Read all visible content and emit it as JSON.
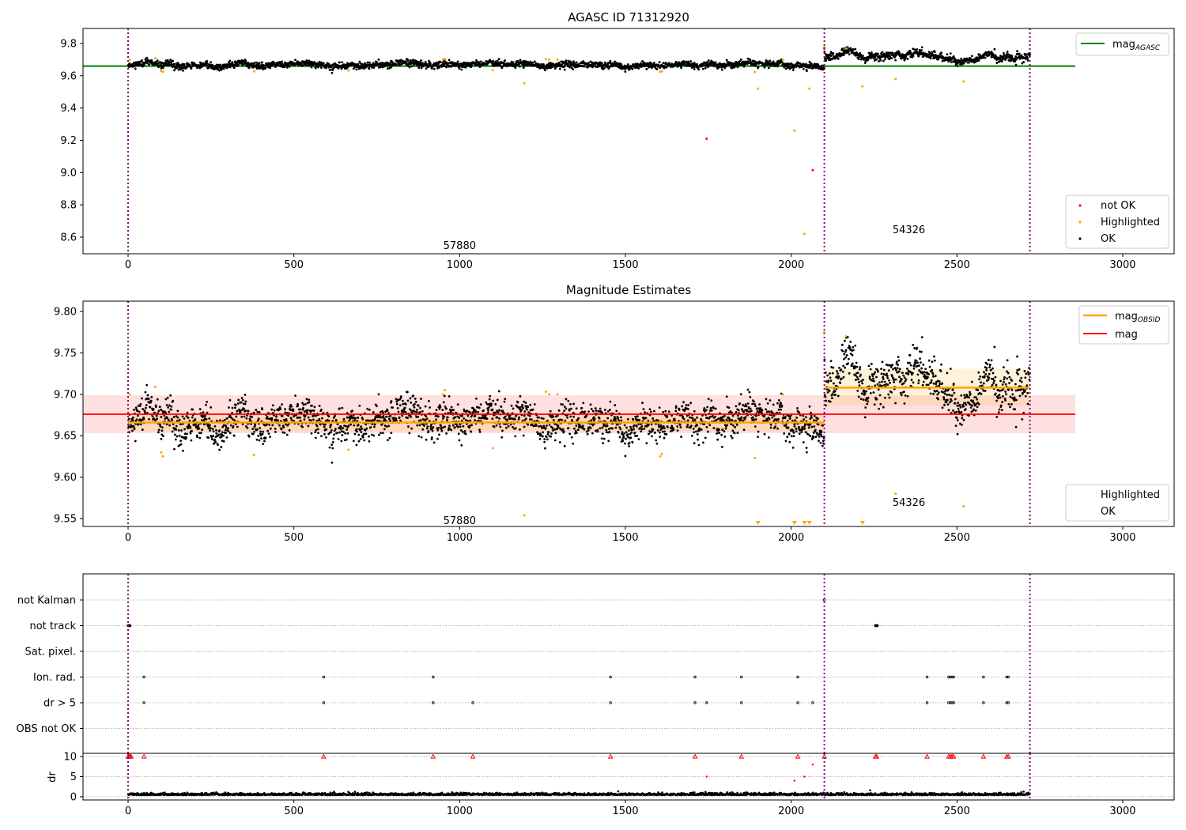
{
  "chart_data": [
    {
      "type": "scatter",
      "title": "AGASC ID 71312920",
      "ylim": [
        8.497,
        9.893
      ],
      "xlim": [
        -137,
        3154
      ],
      "xticks": [
        0,
        500,
        1000,
        1500,
        2000,
        2500,
        3000
      ],
      "yticks": [
        8.6,
        8.8,
        9.0,
        9.2,
        9.4,
        9.6,
        9.8
      ],
      "legend_upper": {
        "placement": "top-right",
        "entries": [
          "mag_AGASC"
        ]
      },
      "legend_lower": {
        "placement": "bottom-right",
        "entries": [
          "not OK",
          "Highlighted",
          "OK"
        ]
      },
      "mag_agasc": 9.66,
      "obsid_labels": [
        {
          "text": "57880",
          "x": 1000,
          "y": 8.55
        },
        {
          "text": "54326",
          "x": 2355,
          "y": 8.65
        }
      ],
      "not_ok": [
        [
          1745,
          9.21
        ],
        [
          2065,
          9.015
        ],
        [
          2100,
          9.77
        ]
      ]
    },
    {
      "type": "scatter",
      "title": "Magnitude Estimates",
      "ylim": [
        9.5405,
        9.8124
      ],
      "xlim": [
        -137,
        3154
      ],
      "xticks": [
        0,
        500,
        1000,
        1500,
        2000,
        2500,
        3000
      ],
      "yticks": [
        9.55,
        9.6,
        9.65,
        9.7,
        9.75,
        9.8
      ],
      "legend_upper": {
        "placement": "top-right",
        "entries": [
          "mag_OBSID",
          "mag"
        ]
      },
      "legend_lower": {
        "placement": "bottom-right",
        "entries": [
          "Highlighted",
          "OK"
        ]
      },
      "mag": 9.676,
      "mag_band": [
        9.653,
        9.699
      ],
      "obsid_labels": [
        {
          "text": "57880",
          "x": 1000,
          "y": 9.548
        },
        {
          "text": "54326",
          "x": 2355,
          "y": 9.57
        }
      ]
    },
    {
      "type": "scatter",
      "title": "Flags",
      "categories": [
        "not Kalman",
        "not track",
        "Sat. pixel.",
        "Ion. rad.",
        "dr > 5",
        "OBS not OK"
      ],
      "flags": {
        "not Kalman": [
          2100
        ],
        "not track": [
          0,
          2,
          4,
          6,
          2254,
          2256,
          2258,
          2260
        ],
        "Sat. pixel.": [],
        "Ion. rad.": [
          48,
          590,
          920,
          1455,
          1710,
          1850,
          2020,
          2410,
          2475,
          2480,
          2485,
          2490,
          2580,
          2650,
          2655
        ],
        "dr > 5": [
          48,
          590,
          920,
          1040,
          1455,
          1710,
          1745,
          1850,
          2020,
          2065,
          2410,
          2475,
          2480,
          2485,
          2490,
          2580,
          2650,
          2655
        ],
        "OBS not OK": []
      }
    },
    {
      "type": "scatter",
      "ylabel": "dr",
      "ylim": [
        -0.8,
        10.8
      ],
      "yticks": [
        0,
        5,
        10
      ],
      "xticks": [
        0,
        500,
        1000,
        1500,
        2000,
        2500,
        3000
      ],
      "clipped_at_10": [
        0,
        3,
        6,
        9,
        48,
        590,
        920,
        1040,
        1455,
        1710,
        1850,
        2020,
        2100,
        2254,
        2258,
        2410,
        2475,
        2480,
        2485,
        2490,
        2580,
        2650,
        2655
      ],
      "red_points": [
        [
          1745,
          5
        ],
        [
          2010,
          4
        ],
        [
          2040,
          5
        ],
        [
          2065,
          8
        ]
      ],
      "ok_level": 0.5
    }
  ],
  "observations": [
    {
      "obsid": "57880",
      "start": 0,
      "end": 2100,
      "mean": 9.666,
      "std": 0.012,
      "band": [
        9.655,
        9.677
      ]
    },
    {
      "obsid": "54326",
      "start": 2100,
      "end": 2720,
      "mean": 9.708,
      "std": 0.02,
      "band": [
        9.686,
        9.731
      ]
    }
  ],
  "highlighted": [
    [
      5,
      9.7
    ],
    [
      82,
      9.709
    ],
    [
      100,
      9.63
    ],
    [
      105,
      9.625
    ],
    [
      380,
      9.627
    ],
    [
      665,
      9.633
    ],
    [
      950,
      9.7
    ],
    [
      955,
      9.705
    ],
    [
      1100,
      9.635
    ],
    [
      1195,
      9.554
    ],
    [
      1260,
      9.703
    ],
    [
      1270,
      9.7
    ],
    [
      1295,
      9.7
    ],
    [
      1605,
      9.625
    ],
    [
      1610,
      9.628
    ],
    [
      1890,
      9.623
    ],
    [
      1900,
      9.52
    ],
    [
      1975,
      9.7
    ],
    [
      2010,
      9.26
    ],
    [
      2040,
      8.62
    ],
    [
      2055,
      9.52
    ],
    [
      2100,
      9.775
    ],
    [
      2165,
      9.77
    ],
    [
      2215,
      9.535
    ],
    [
      2315,
      9.58
    ],
    [
      2520,
      9.565
    ]
  ],
  "obs_boundaries": [
    0,
    2100,
    2720
  ],
  "colors": {
    "ok": "#000000",
    "highlighted": "#ffa500",
    "not_ok": "#ff0000",
    "agasc": "#008000",
    "mag": "#ff0000",
    "obsid": "#ffa500",
    "boundary": "#800080"
  }
}
